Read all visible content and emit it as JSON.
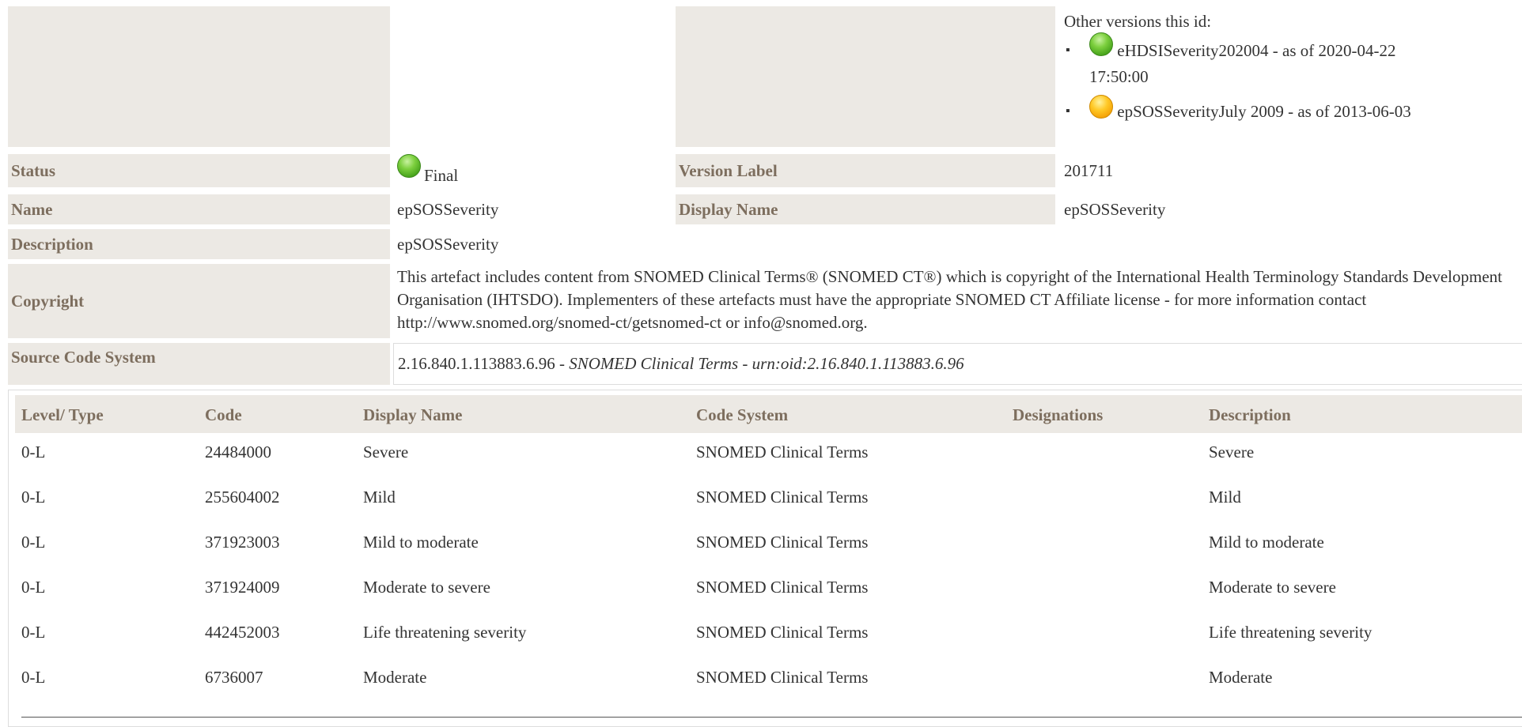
{
  "other_versions": {
    "heading": "Other versions this id:",
    "items": [
      {
        "status": "green",
        "line1": "eHDSISeverity202004 - as of 2020-04-22",
        "line2": "17:50:00"
      },
      {
        "status": "yellow",
        "line1": "epSOSSeverityJuly 2009 - as of 2013-06-03"
      }
    ]
  },
  "fields": {
    "status_label": "Status",
    "status_value": "Final",
    "version_label_label": "Version Label",
    "version_label_value": "201711",
    "name_label": "Name",
    "name_value": "epSOSSeverity",
    "display_name_label": "Display Name",
    "display_name_value": "epSOSSeverity",
    "description_label": "Description",
    "description_value": "epSOSSeverity",
    "copyright_label": "Copyright",
    "copyright_value": "This artefact includes content from SNOMED Clinical Terms® (SNOMED CT®) which is copyright of the International Health Terminology Standards Development Organisation (IHTSDO). Implementers of these artefacts must have the appropriate SNOMED CT Affiliate license - for more information contact http://www.snomed.org/snomed-ct/getsnomed-ct or info@snomed.org.",
    "source_code_system_label": "Source Code System",
    "source_oid": "2.16.840.1.113883.6.96",
    "source_sep": " - ",
    "source_name": "SNOMED Clinical Terms",
    "source_urn": "urn:oid:2.16.840.1.113883.6.96"
  },
  "concepts_table": {
    "headers": [
      "Level/ Type",
      "Code",
      "Display Name",
      "Code System",
      "Designations",
      "Description"
    ],
    "rows": [
      {
        "level": "0-L",
        "code": "24484000",
        "display": "Severe",
        "system": "SNOMED Clinical Terms",
        "designations": "",
        "description": "Severe"
      },
      {
        "level": "0-L",
        "code": "255604002",
        "display": "Mild",
        "system": "SNOMED Clinical Terms",
        "designations": "",
        "description": "Mild"
      },
      {
        "level": "0-L",
        "code": "371923003",
        "display": "Mild to moderate",
        "system": "SNOMED Clinical Terms",
        "designations": "",
        "description": "Mild to moderate"
      },
      {
        "level": "0-L",
        "code": "371924009",
        "display": "Moderate to severe",
        "system": "SNOMED Clinical Terms",
        "designations": "",
        "description": "Moderate to severe"
      },
      {
        "level": "0-L",
        "code": "442452003",
        "display": "Life threatening severity",
        "system": "SNOMED Clinical Terms",
        "designations": "",
        "description": "Life threatening severity"
      },
      {
        "level": "0-L",
        "code": "6736007",
        "display": "Moderate",
        "system": "SNOMED Clinical Terms",
        "designations": "",
        "description": "Moderate"
      }
    ]
  }
}
